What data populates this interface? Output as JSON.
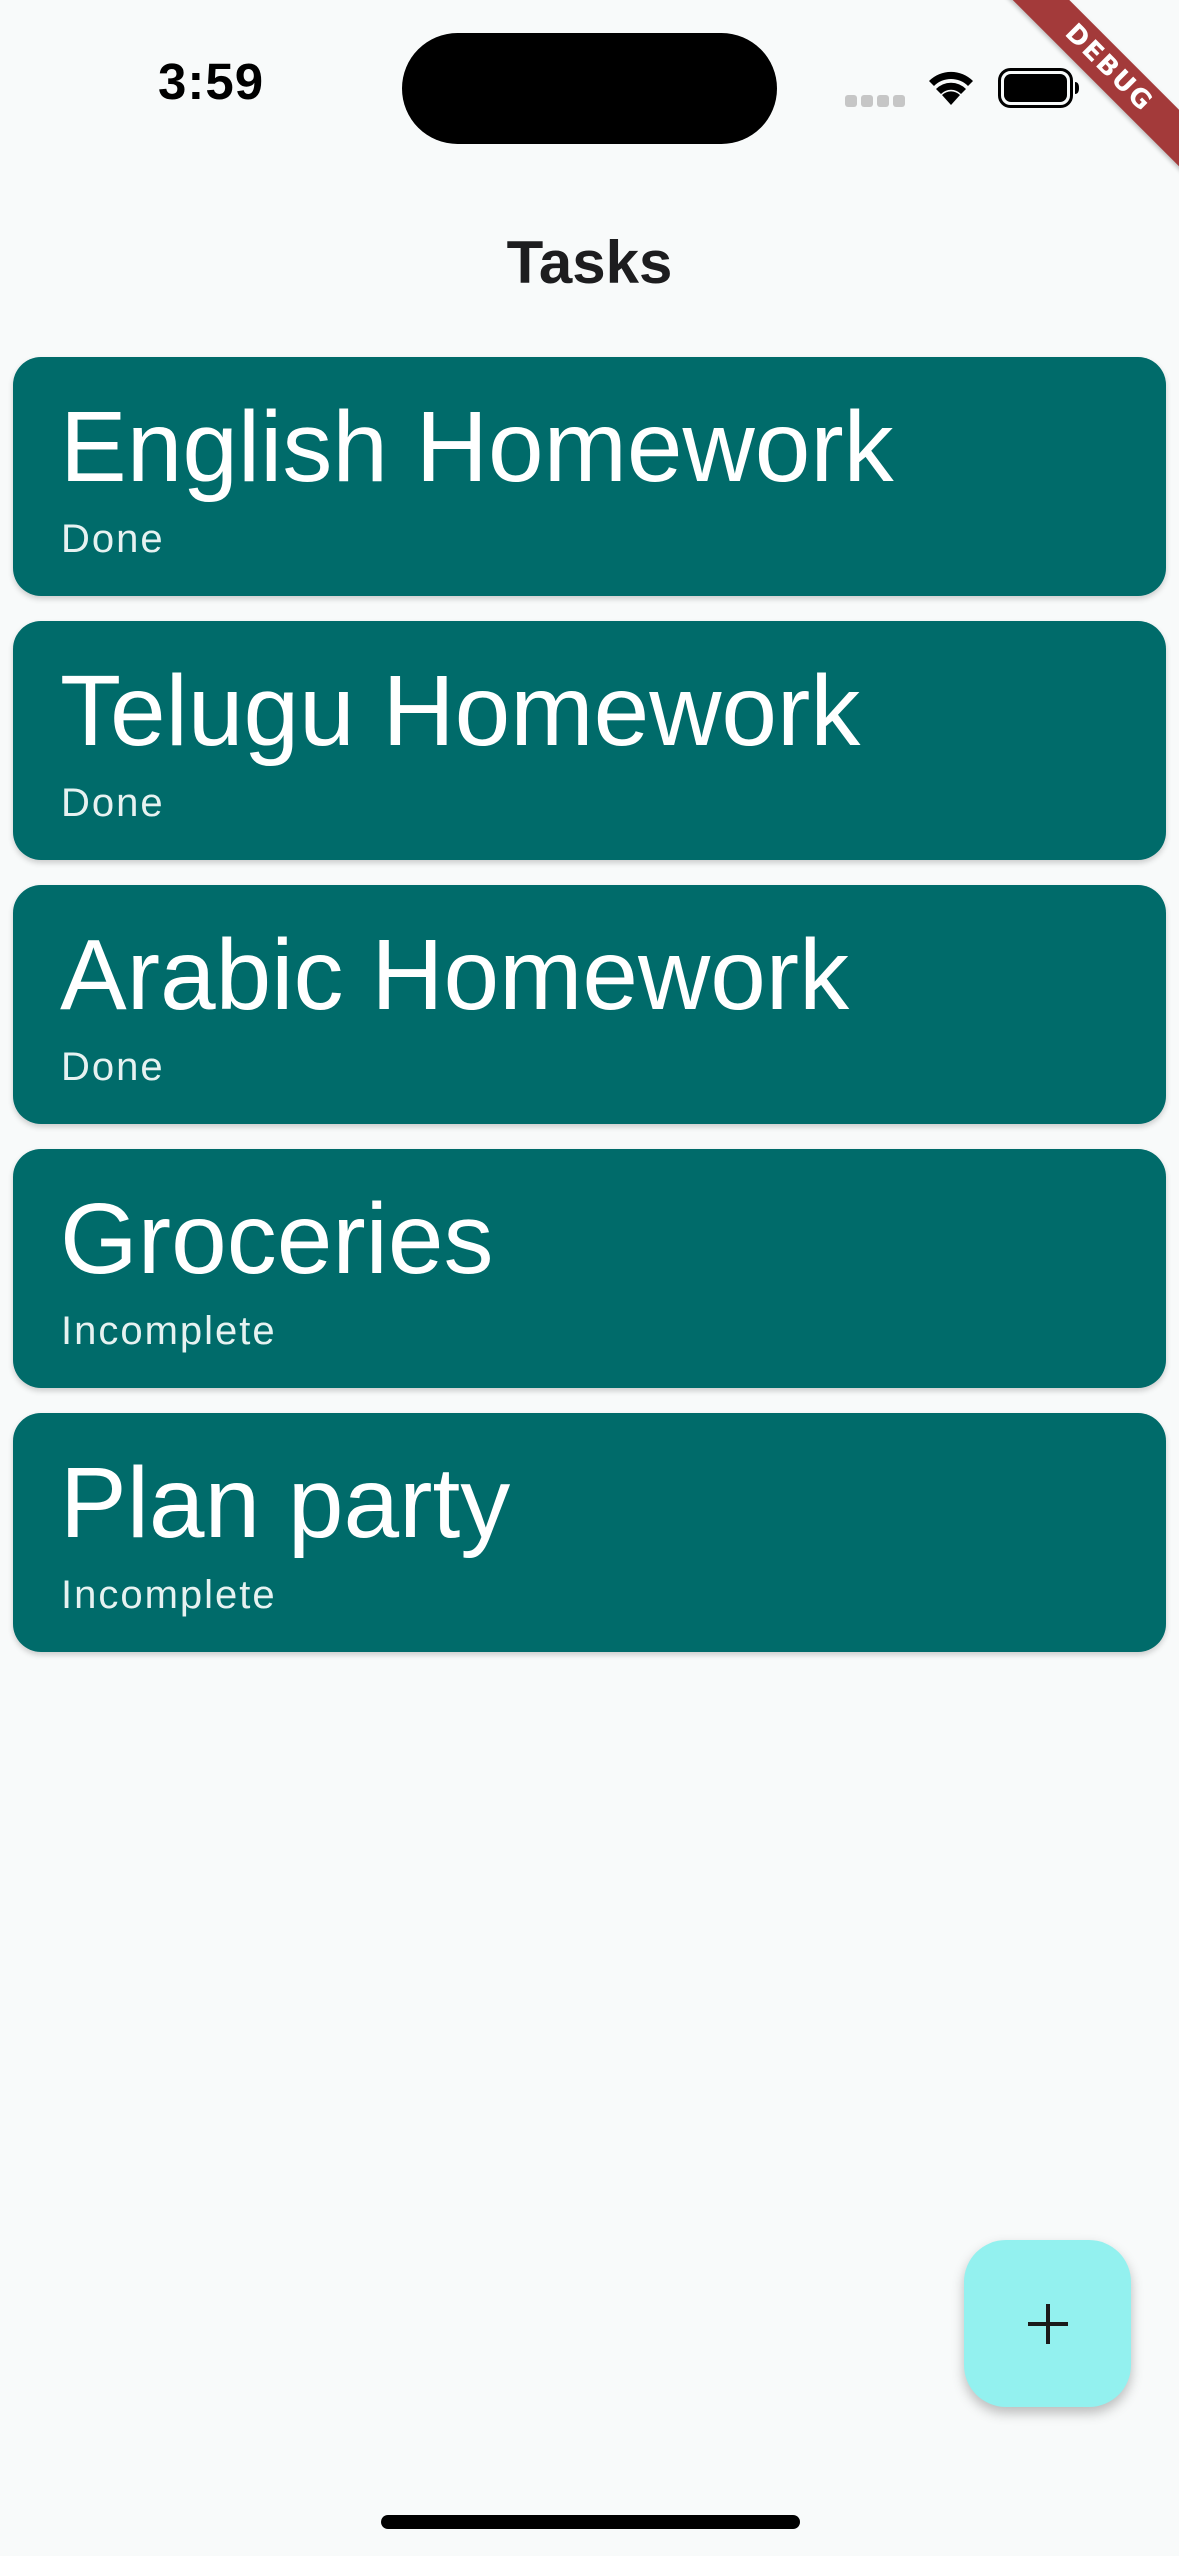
{
  "status_bar": {
    "time": "3:59",
    "icons": [
      "cellular-signal-icon",
      "wifi-icon",
      "battery-icon"
    ]
  },
  "debug_banner": {
    "label": "DEBUG",
    "color": "#a33a3a"
  },
  "app_bar": {
    "title": "Tasks"
  },
  "tasks": [
    {
      "title": "English Homework",
      "status": "Done"
    },
    {
      "title": "Telugu Homework",
      "status": "Done"
    },
    {
      "title": "Arabic Homework",
      "status": "Done"
    },
    {
      "title": "Groceries",
      "status": "Incomplete"
    },
    {
      "title": "Plan party",
      "status": "Incomplete"
    }
  ],
  "fab": {
    "icon": "plus-icon"
  },
  "colors": {
    "card_background": "#006b6a",
    "fab_background": "#93f1ef",
    "page_background": "#f8fafa"
  }
}
